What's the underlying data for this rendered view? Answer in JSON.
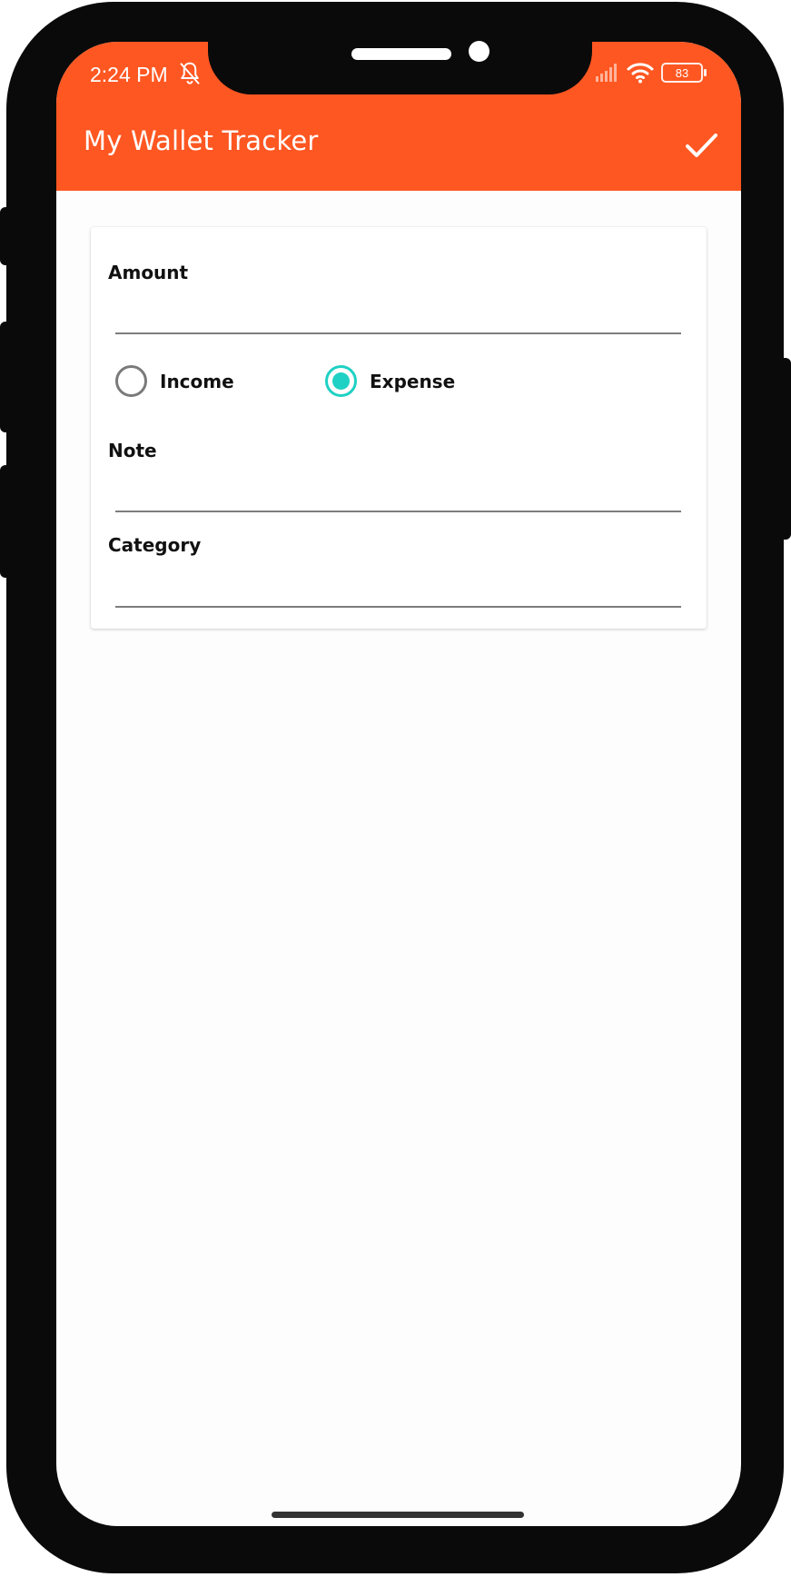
{
  "status_bar": {
    "time": "2:24 PM",
    "battery_level": "83",
    "icons": [
      "bell-off-icon",
      "signal-icon",
      "wifi-icon",
      "battery-icon"
    ]
  },
  "app_bar": {
    "title": "My Wallet Tracker",
    "action_icon": "check-icon",
    "color": "#ff5722"
  },
  "form": {
    "amount": {
      "label": "Amount",
      "value": ""
    },
    "type_options": [
      {
        "label": "Income",
        "selected": false
      },
      {
        "label": "Expense",
        "selected": true
      }
    ],
    "note": {
      "label": "Note",
      "value": ""
    },
    "category": {
      "label": "Category",
      "value": ""
    },
    "accent_color": "#1ed1c4"
  }
}
